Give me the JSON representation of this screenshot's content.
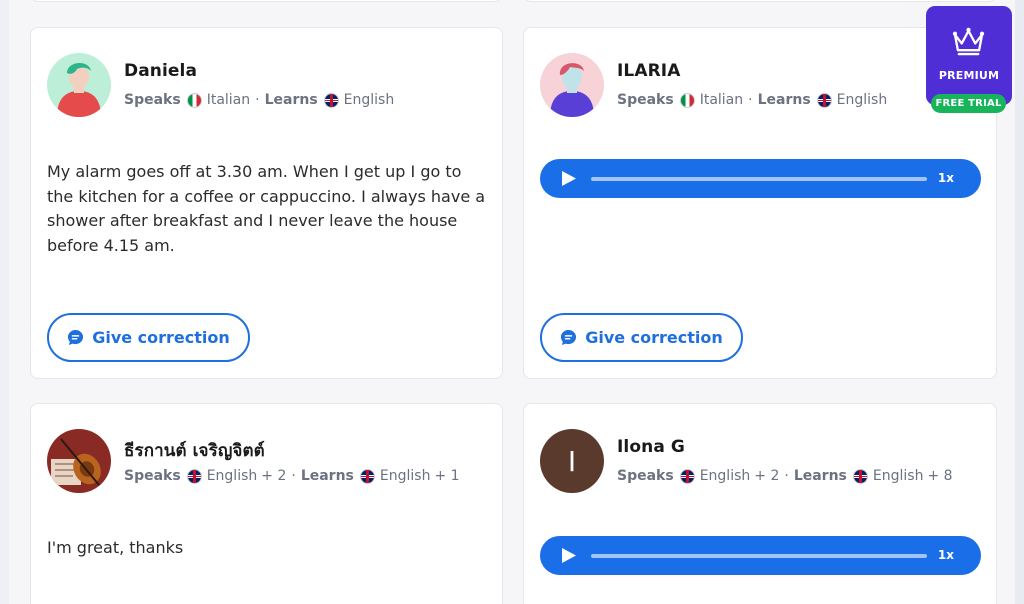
{
  "labels": {
    "speaks": "Speaks",
    "learns": "Learns",
    "give_correction": "Give correction"
  },
  "premium": {
    "label": "PREMIUM",
    "free_trial": "FREE TRIAL",
    "color": "#4f2ed6",
    "trial_color": "#18b45b"
  },
  "accent_color": "#1f6fdc",
  "posts": [
    {
      "name": "Daniela",
      "avatar": "illustrated-avatar-green-hair",
      "speaks": "Italian",
      "speaks_flag": "italy-flag",
      "learns": "English",
      "learns_flag": "uk-flag",
      "text": "My alarm goes off at 3.30 am. When I get up I go to the kitchen for a coffee or cappuccino. I always have a shower after breakfast and I never leave the house before 4.15 am."
    },
    {
      "name": "ILARIA",
      "avatar": "illustrated-avatar-purple",
      "speaks": "Italian",
      "speaks_flag": "italy-flag",
      "learns": "English",
      "learns_flag": "uk-flag",
      "audio_speed": "1x"
    },
    {
      "name": "ธีรกานต์ เจริญจิตต์",
      "avatar": "photo-violin",
      "speaks": "English",
      "speaks_extra": "+ 2",
      "learns": "English",
      "learns_extra": "+ 1",
      "text": "I'm great, thanks"
    },
    {
      "name": "Ilona G",
      "avatar_initial": "I",
      "speaks": "English",
      "speaks_extra": "+ 2",
      "learns": "English",
      "learns_extra": "+ 8",
      "audio_speed": "1x"
    }
  ]
}
